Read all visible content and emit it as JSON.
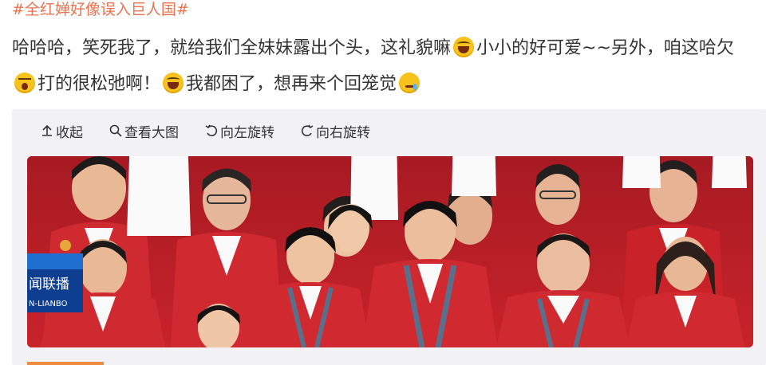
{
  "topic": "#全红婵好像误入巨人国#",
  "post": {
    "part1": "哈哈哈，笑死我了，就给我们全妹妹露出个头，这礼貌嘛",
    "emoji1": "laugh-emoji",
    "part2": "小小的好可爱~~另外，咱这哈欠",
    "emoji2": "yawn-emoji",
    "part3": "打的很松弛啊！",
    "emoji3": "laugh-emoji",
    "part4": "我都困了，想再来个回笼觉",
    "emoji4": "sleepy-emoji"
  },
  "toolbar": {
    "collapse": "收起",
    "view_large": "查看大图",
    "rotate_left": "向左旋转",
    "rotate_right": "向右旋转"
  },
  "photo": {
    "logo_text": "闻联播",
    "logo_sub": "N-LIANBO"
  },
  "colors": {
    "topic": "#eb7350",
    "text": "#333333",
    "card_bg": "#f2f2f5",
    "jacket_red": "#c8232b"
  }
}
